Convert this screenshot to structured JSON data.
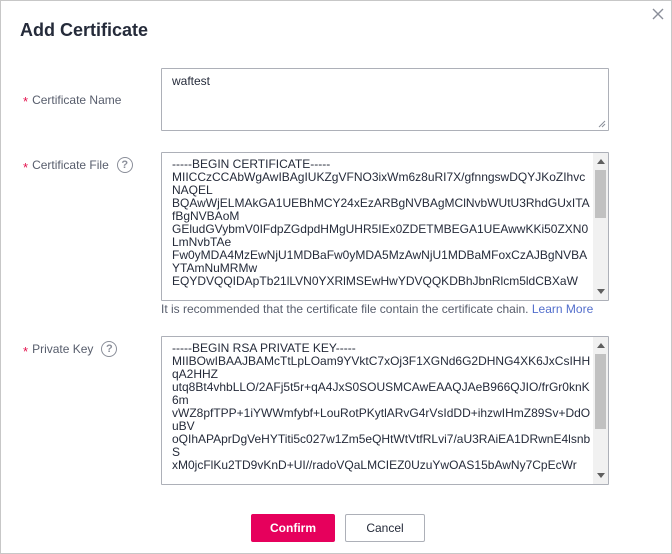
{
  "dialog": {
    "title": "Add Certificate",
    "close_icon": "close-icon"
  },
  "form": {
    "required_mark": "*",
    "help_mark": "?",
    "certificate_name": {
      "label": "Certificate Name",
      "value": "waftest"
    },
    "certificate_file": {
      "label": "Certificate File",
      "value": "-----BEGIN CERTIFICATE-----\nMIICCzCCAbWgAwIBAgIUKZgVFNO3ixWm6z8uRI7X/gfnngswDQYJKoZIhvcNAQEL\nBQAwWjELMAkGA1UEBhMCY24xEzARBgNVBAgMClNvbWUtU3RhdGUxITAfBgNVBAoM\nGEludGVybmV0IFdpZGdpdHMgUHR5IEx0ZDETMBEGA1UEAwwKKi50ZXN0LmNvbTAe\nFw0yMDA4MzEwNjU1MDBaFw0yMDA5MzAwNjU1MDBaMFoxCzAJBgNVBAYTAmNuMRMw\nEQYDVQQIDApTb21lLVN0YXRlMSEwHwYDVQQKDBhJbnRlcm5ldCBXaW",
      "hint_text": "It is recommended that the certificate file contain the certificate chain.",
      "hint_link": "Learn More"
    },
    "private_key": {
      "label": "Private Key",
      "value": "-----BEGIN RSA PRIVATE KEY-----\nMIIBOwIBAAJBAMcTtLpLOam9YVktC7xOj3F1XGNd6G2DHNG4XK6JxCsIHHqA2HHZ\nutq8Bt4vhbLLO/2AFj5t5r+qA4JxS0SOUSMCAwEAAQJAeB966QJIO/frGr0knK6m\nvWZ8pfTPP+1iYWWmfybf+LouRotPKytlARvG4rVsIdDD+ihzwIHmZ89Sv+DdOuBV\noQIhAPAprDgVeHYTiti5c027w1Zm5eQHtWtVtfRLvi7/aU3RAiEA1DRwnE4lsnbS\nxM0jcFlKu2TD9vKnD+UI//radoVQaLMCIEZ0UzuYwOAS15bAwNy7CpEcWr"
    }
  },
  "footer": {
    "confirm_label": "Confirm",
    "cancel_label": "Cancel"
  },
  "colors": {
    "primary": "#e6005c",
    "required": "#e4104c",
    "link": "#526ecc"
  }
}
